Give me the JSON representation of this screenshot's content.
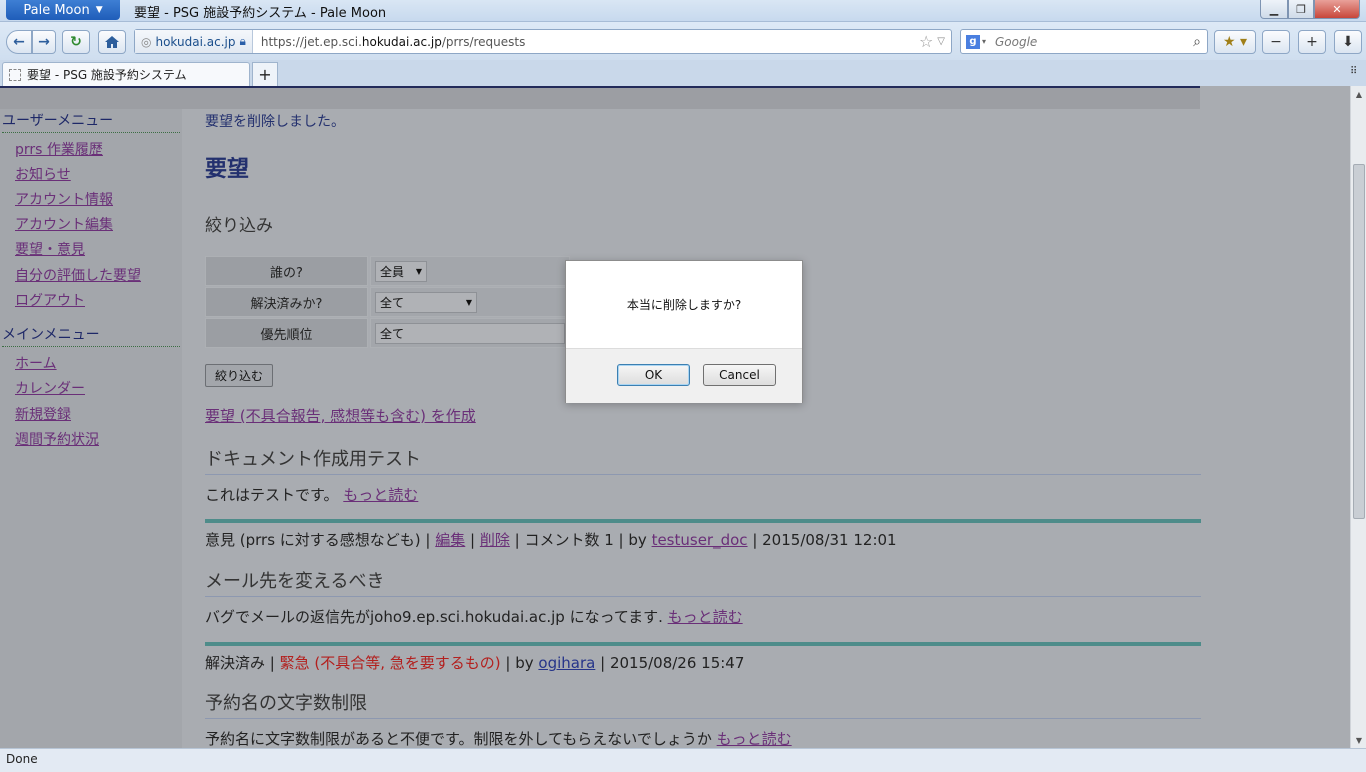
{
  "browser": {
    "app_menu": "Pale Moon",
    "window_title": "要望 - PSG 施設予約システム - Pale Moon",
    "identity_domain": "hokudai.ac.jp",
    "url_prefix": "https://jet.ep.sci.",
    "url_host": "hokudai.ac.jp",
    "url_path": "/prrs/requests",
    "search_placeholder": "Google",
    "tab_title": "要望 - PSG 施設予約システム",
    "status": "Done",
    "accent_color": "#2463c2"
  },
  "sidebar": {
    "user_menu_heading": "ユーザーメニュー",
    "user_items": [
      "prrs 作業履歴",
      "お知らせ",
      "アカウント情報",
      "アカウント編集",
      "要望・意見",
      "自分の評価した要望",
      "ログアウト"
    ],
    "main_menu_heading": "メインメニュー",
    "main_items": [
      "ホーム",
      "カレンダー",
      "新規登録",
      "週間予約状況"
    ]
  },
  "main": {
    "flash": "要望を削除しました。",
    "title": "要望",
    "filter_heading": "絞り込み",
    "filters": [
      {
        "label": "誰の?",
        "value": "全員"
      },
      {
        "label": "解決済みか?",
        "value": "全て"
      },
      {
        "label": "優先順位",
        "value": "全て"
      }
    ],
    "filter_button": "絞り込む",
    "create_link": "要望 (不具合報告, 感想等も含む) を作成",
    "posts": [
      {
        "title": "ドキュメント作成用テスト",
        "body": "これはテストです。",
        "more": "もっと読む",
        "meta": {
          "category": "意見 (prrs に対する感想なども)",
          "edit": "編集",
          "delete": "削除",
          "comments": "コメント数 1",
          "by": "by",
          "author": "testuser_doc",
          "date": "2015/08/31 12:01"
        }
      },
      {
        "title": "メール先を変えるべき",
        "body": "バグでメールの返信先がjoho9.ep.sci.hokudai.ac.jp になってます.",
        "more": "もっと読む",
        "meta": {
          "status": "解決済み",
          "priority": "緊急 (不具合等, 急を要するもの)",
          "by": "by",
          "author": "ogihara",
          "date": "2015/08/26 15:47"
        }
      },
      {
        "title": "予約名の文字数制限",
        "body": "予約名に文字数制限があると不便です。制限を外してもらえないでしょうか",
        "more": "もっと読む"
      }
    ]
  },
  "dialog": {
    "message": "本当に削除しますか?",
    "ok": "OK",
    "cancel": "Cancel"
  }
}
